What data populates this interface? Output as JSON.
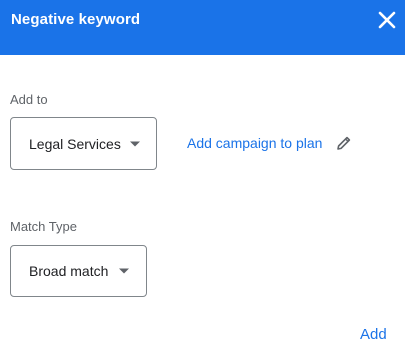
{
  "dialog": {
    "title": "Negative keyword",
    "close_icon": "close-icon"
  },
  "add_to": {
    "label": "Add to",
    "selected": "Legal Services",
    "add_campaign_link": "Add campaign to plan",
    "edit_icon": "pencil-icon"
  },
  "match_type": {
    "label": "Match Type",
    "selected": "Broad match"
  },
  "footer": {
    "add_button": "Add"
  },
  "colors": {
    "header": "#1a73e8",
    "link": "#1a73e8",
    "label": "#5f6368",
    "border": "#80868b"
  }
}
